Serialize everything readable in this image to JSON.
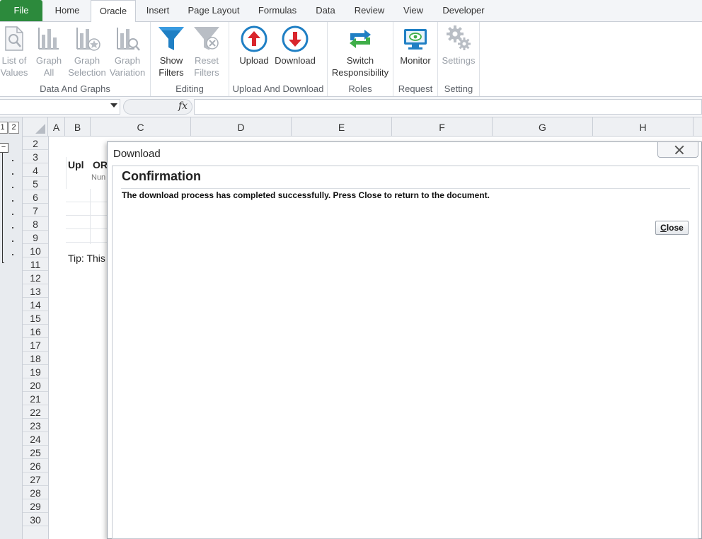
{
  "tabs": {
    "file": "File",
    "home": "Home",
    "oracle": "Oracle",
    "insert": "Insert",
    "page_layout": "Page Layout",
    "formulas": "Formulas",
    "data": "Data",
    "review": "Review",
    "view": "View",
    "developer": "Developer"
  },
  "ribbon": {
    "data_and_graphs": {
      "label": "Data And Graphs",
      "list_of_values": {
        "l1": "List of",
        "l2": "Values"
      },
      "graph_all": {
        "l1": "Graph",
        "l2": "All"
      },
      "graph_selection": {
        "l1": "Graph",
        "l2": "Selection"
      },
      "graph_variation": {
        "l1": "Graph",
        "l2": "Variation"
      }
    },
    "editing": {
      "label": "Editing",
      "show_filters": {
        "l1": "Show",
        "l2": "Filters"
      },
      "reset_filters": {
        "l1": "Reset",
        "l2": "Filters"
      }
    },
    "upload_download": {
      "label": "Upload And Download",
      "upload": "Upload",
      "download": "Download"
    },
    "roles": {
      "label": "Roles",
      "switch_responsibility": {
        "l1": "Switch",
        "l2": "Responsibility"
      }
    },
    "request": {
      "label": "Request",
      "monitor": "Monitor"
    },
    "setting": {
      "label": "Setting",
      "settings": "Settings"
    }
  },
  "formula_bar": {
    "fx": "fx"
  },
  "outline": {
    "level1": "1",
    "level2": "2",
    "collapse": "−"
  },
  "columns": [
    "A",
    "B",
    "C",
    "D",
    "E",
    "F",
    "G",
    "H"
  ],
  "rows": [
    "2",
    "3",
    "4",
    "5",
    "6",
    "7",
    "8",
    "9",
    "10",
    "11",
    "12",
    "13",
    "14",
    "15",
    "16",
    "17",
    "18",
    "19",
    "20",
    "21",
    "22",
    "23",
    "24",
    "25",
    "26",
    "27",
    "28",
    "29",
    "30"
  ],
  "sheet": {
    "header_b3": "Upl",
    "header_c3": "OR",
    "sub_c4": "Nun",
    "tip": "Tip: This"
  },
  "dialog": {
    "title": "Download",
    "heading": "Confirmation",
    "message": "The download process has completed successfully. Press Close to return to the document.",
    "close_accesskey": "C",
    "close_rest": "lose"
  },
  "colors": {
    "file_tab": "#2c8a3c",
    "accent_blue": "#1f7fc4",
    "arrow_red": "#d9262c",
    "switch_green": "#3fae49"
  }
}
